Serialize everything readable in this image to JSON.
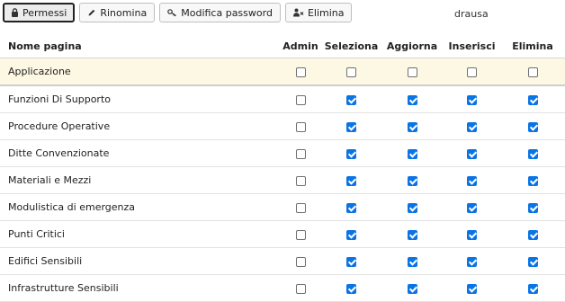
{
  "toolbar": {
    "permessi_label": "Permessi",
    "rinomina_label": "Rinomina",
    "modifica_label": "Modifica password",
    "elimina_label": "Elimina"
  },
  "user": {
    "name": "drausa"
  },
  "table": {
    "headers": {
      "name": "Nome pagina",
      "admin": "Admin",
      "seleziona": "Seleziona",
      "aggiorna": "Aggiorna",
      "inserisci": "Inserisci",
      "elimina": "Elimina"
    },
    "rows": [
      {
        "name": "Applicazione",
        "admin": false,
        "seleziona": false,
        "aggiorna": false,
        "inserisci": false,
        "elimina": false
      },
      {
        "name": "Funzioni Di Supporto",
        "admin": false,
        "seleziona": true,
        "aggiorna": true,
        "inserisci": true,
        "elimina": true
      },
      {
        "name": "Procedure Operative",
        "admin": false,
        "seleziona": true,
        "aggiorna": true,
        "inserisci": true,
        "elimina": true
      },
      {
        "name": "Ditte Convenzionate",
        "admin": false,
        "seleziona": true,
        "aggiorna": true,
        "inserisci": true,
        "elimina": true
      },
      {
        "name": "Materiali e Mezzi",
        "admin": false,
        "seleziona": true,
        "aggiorna": true,
        "inserisci": true,
        "elimina": true
      },
      {
        "name": "Modulistica di emergenza",
        "admin": false,
        "seleziona": true,
        "aggiorna": true,
        "inserisci": true,
        "elimina": true
      },
      {
        "name": "Punti Critici",
        "admin": false,
        "seleziona": true,
        "aggiorna": true,
        "inserisci": true,
        "elimina": true
      },
      {
        "name": "Edifici Sensibili",
        "admin": false,
        "seleziona": true,
        "aggiorna": true,
        "inserisci": true,
        "elimina": true
      },
      {
        "name": "Infrastrutture Sensibili",
        "admin": false,
        "seleziona": true,
        "aggiorna": true,
        "inserisci": true,
        "elimina": true
      }
    ]
  },
  "colors": {
    "checkbox_checked": "#0b74e5",
    "highlight_row": "#fcf8e3"
  }
}
